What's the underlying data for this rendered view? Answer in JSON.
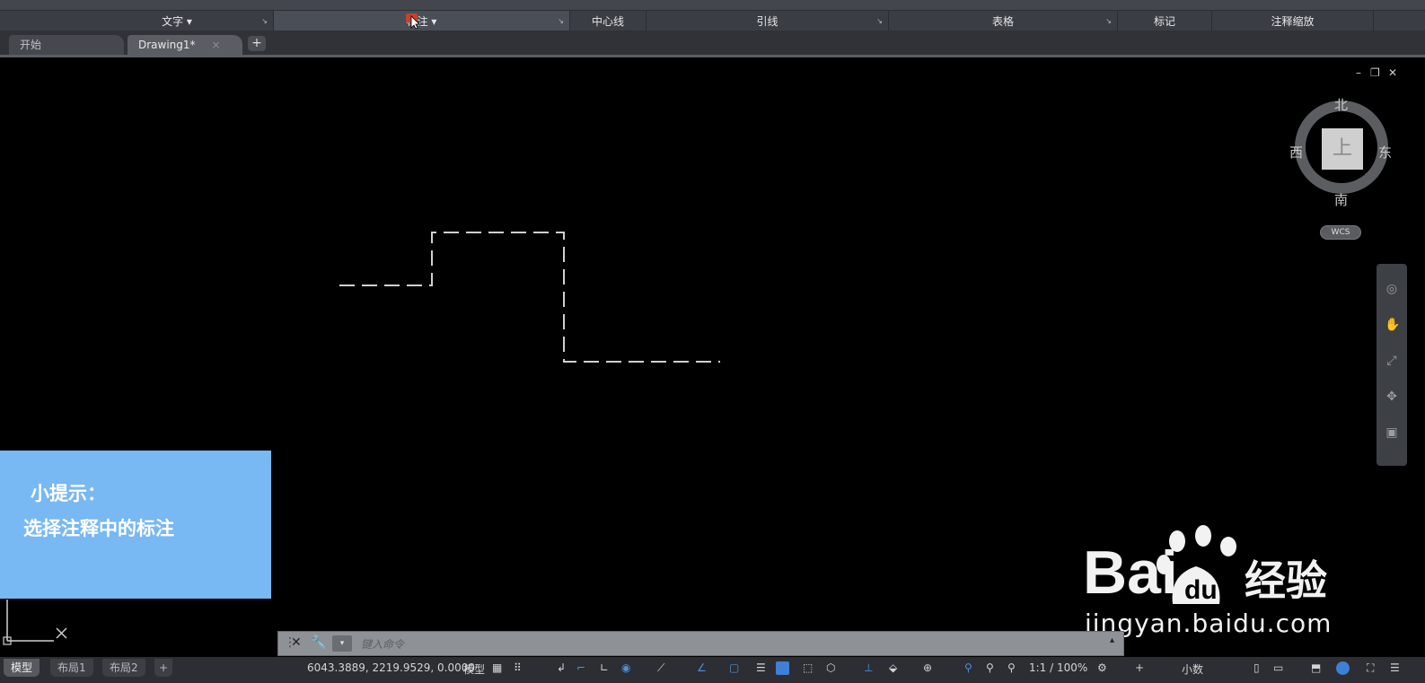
{
  "ribbon": {
    "panels": [
      {
        "label": "文字 ▾"
      },
      {
        "label": "标注 ▾"
      },
      {
        "label": "中心线"
      },
      {
        "label": "引线"
      },
      {
        "label": "表格"
      },
      {
        "label": "标记"
      },
      {
        "label": "注释缩放"
      }
    ]
  },
  "tabs": [
    {
      "label": "开始"
    },
    {
      "label": "Drawing1*"
    }
  ],
  "viewcube": {
    "north": "北",
    "south": "南",
    "east": "东",
    "west": "西",
    "top_face": "上",
    "wcs": "WCS"
  },
  "hint": {
    "title": "小提示：",
    "body": "选择注释中的标注"
  },
  "watermark": {
    "url": "jingyan.baidu.com"
  },
  "command": {
    "placeholder": "键入命令"
  },
  "status": {
    "layout_tabs": [
      {
        "label": "模型"
      },
      {
        "label": "布局1"
      },
      {
        "label": "布局2"
      }
    ],
    "coords": "6043.3889, 2219.9529, 0.0000",
    "model_label": "模型",
    "scale": "1:1 / 100%",
    "units": "小数"
  },
  "colors": {
    "hint_bg": "#78b8f3",
    "canvas_bg": "#000000",
    "ribbon_bg": "#3a3d43"
  }
}
